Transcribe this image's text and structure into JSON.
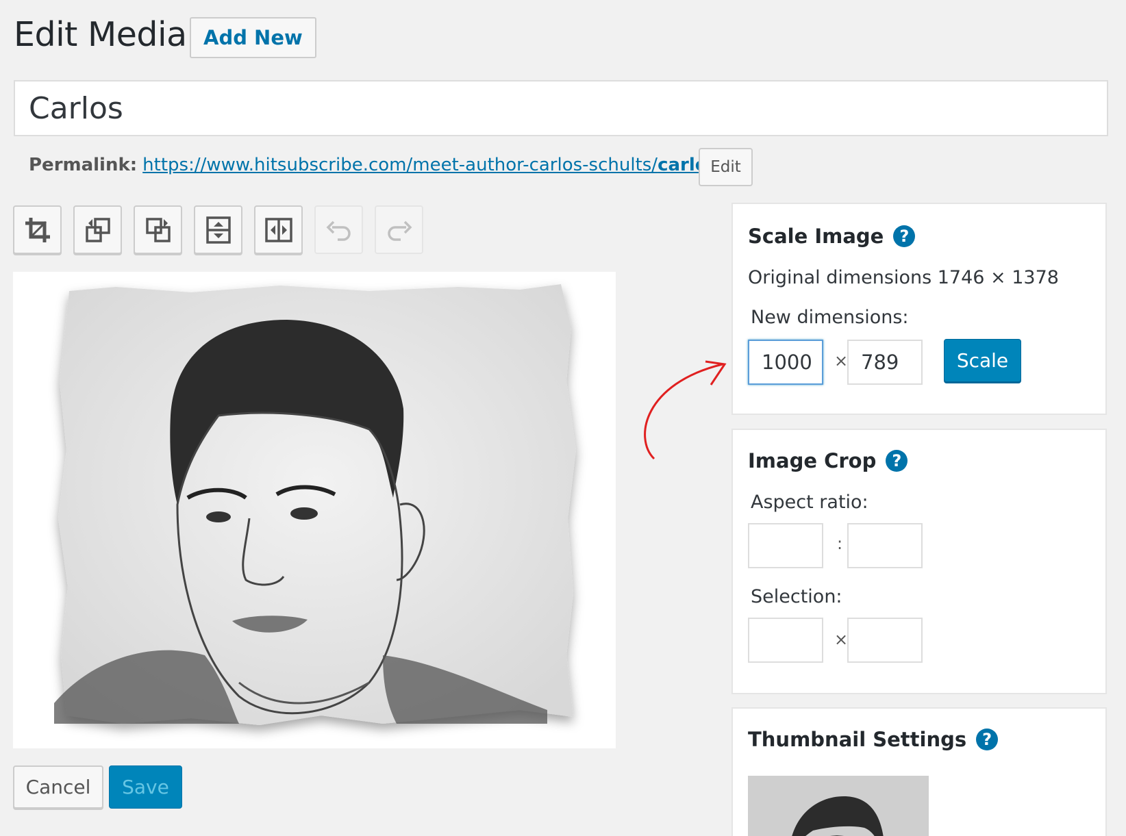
{
  "header": {
    "title": "Edit Media",
    "add_new": "Add New"
  },
  "media": {
    "title_value": "Carlos"
  },
  "permalink": {
    "label": "Permalink:",
    "url_prefix": "https://www.hitsubscribe.com/meet-author-carlos-schults/",
    "url_slug": "carlos",
    "url_suffix": "/",
    "edit": "Edit"
  },
  "toolbar": {
    "icons": [
      "crop-icon",
      "rotate-left-icon",
      "rotate-right-icon",
      "flip-vertical-icon",
      "flip-horizontal-icon",
      "undo-icon",
      "redo-icon"
    ]
  },
  "actions": {
    "cancel": "Cancel",
    "save": "Save"
  },
  "scale_panel": {
    "heading": "Scale Image",
    "help": "?",
    "original_label": "Original dimensions 1746 × 1378",
    "new_label": "New dimensions:",
    "width": "1000",
    "height": "789",
    "times": "×",
    "button": "Scale"
  },
  "crop_panel": {
    "heading": "Image Crop",
    "help": "?",
    "aspect_label": "Aspect ratio:",
    "aspect_sep": ":",
    "selection_label": "Selection:",
    "selection_sep": "×"
  },
  "thumb_panel": {
    "heading": "Thumbnail Settings",
    "help": "?"
  },
  "colors": {
    "accent": "#0085ba",
    "link": "#0073aa",
    "arrow": "#e02020"
  }
}
